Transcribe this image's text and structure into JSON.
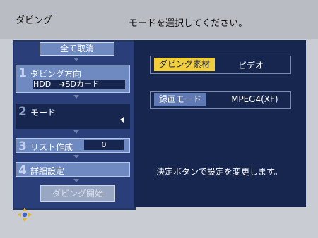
{
  "header": {
    "screen_title": "ダビング",
    "instruction": "モードを選択してください。"
  },
  "left_panel": {
    "cancel_all_label": "全て取消",
    "steps": [
      {
        "number": "1",
        "label": "ダビング方向",
        "value": "HDD　➜SDカード"
      },
      {
        "number": "2",
        "label": "モード"
      },
      {
        "number": "3",
        "label": "リスト作成",
        "value": "0"
      },
      {
        "number": "4",
        "label": "詳細設定"
      }
    ],
    "start_label": "ダビング開始"
  },
  "right_panel": {
    "rows": [
      {
        "label": "ダビング素材",
        "value": "ビデオ"
      },
      {
        "label": "録画モード",
        "value": "MPEG4(XF)"
      }
    ],
    "note": "決定ボタンで設定を変更します。"
  },
  "icons": {
    "dpad": "dpad-icon",
    "mode_arrow": "triangle-left-icon"
  },
  "colors": {
    "selected_badge": "#f1cf3c",
    "panel_bg": "#16264f",
    "step_bg": "#6e8ac0"
  }
}
